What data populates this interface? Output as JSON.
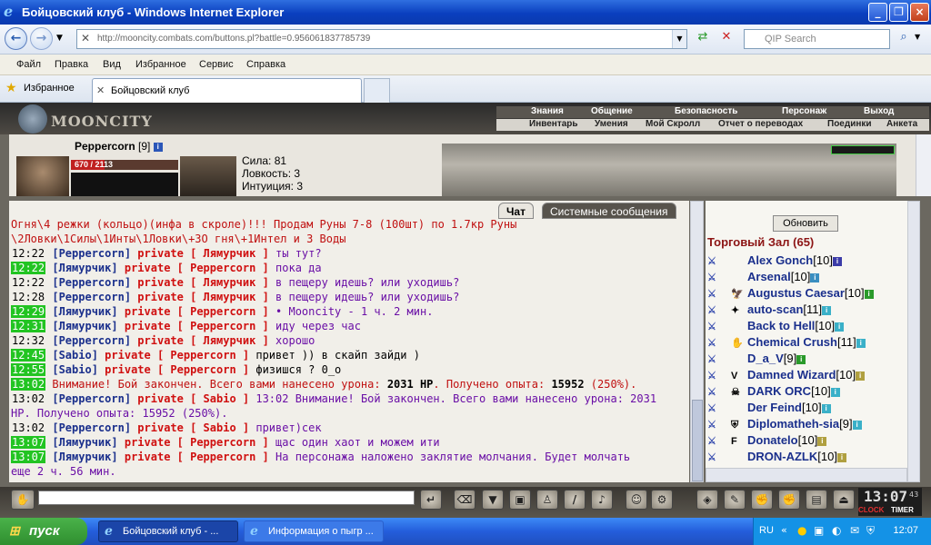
{
  "window": {
    "title": "Бойцовский клуб - Windows Internet Explorer"
  },
  "nav": {
    "url": "http://mooncity.combats.com/buttons.pl?battle=0.956061837785739",
    "search_placeholder": "QIP Search"
  },
  "menu": [
    "Файл",
    "Правка",
    "Вид",
    "Избранное",
    "Сервис",
    "Справка"
  ],
  "favorites_label": "Избранное",
  "tab_label": "Бойцовский клуб",
  "game": {
    "logo": "MOONCITY",
    "menu_top": [
      "Знания",
      "Общение",
      "Безопасность",
      "Персонаж",
      "Выход"
    ],
    "menu_bottom": [
      "Инвентарь",
      "Умения",
      "Мой Скролл",
      "Отчет о переводах",
      "Поединки",
      "Анкета"
    ]
  },
  "player": {
    "nick": "Peppercorn",
    "level": "[9]",
    "hp_text": "670 / 2113",
    "hp_fraction": 0.317
  },
  "stats": [
    "Сила: 81",
    "Ловкость: 3",
    "Интуиция: 3"
  ],
  "chat": {
    "tabs": [
      "Чат",
      "Системные сообщения"
    ],
    "lines": [
      {
        "cls": "rd",
        "parts": [
          {
            "c": "rd",
            "t": "Огня\\4 режки (кольцо)(инфа в скроле)!!! Продам Руны 7-8 (100шт) по 1.7кр"
          },
          {
            "c": "rd",
            "t": "   Руны"
          }
        ]
      },
      {
        "cls": "rd",
        "parts": [
          {
            "c": "rd",
            "t": "\\2Ловки\\1Силы\\1Инты\\1Ловки\\+3О гня\\+1Интел и 3 Воды"
          }
        ]
      },
      {
        "t": "12:22",
        "g": false,
        "nick": "[Peppercorn]",
        "priv": "private [ Лямурчик ]",
        "msg": "ты тут?",
        "mc": "pk"
      },
      {
        "t": "12:22",
        "g": true,
        "nick": "[Лямурчик]",
        "priv": "private [ Peppercorn ]",
        "msg": "пока да",
        "mc": "pk"
      },
      {
        "t": "12:22",
        "g": false,
        "nick": "[Peppercorn]",
        "priv": "private [ Лямурчик ]",
        "msg": "в пещеру идешь? или уходишь?",
        "mc": "pk"
      },
      {
        "t": "12:28",
        "g": false,
        "nick": "[Peppercorn]",
        "priv": "private [ Лямурчик ]",
        "msg": "в пещеру идешь? или уходишь?",
        "mc": "pk"
      },
      {
        "t": "12:29",
        "g": true,
        "nick": "[Лямурчик]",
        "priv": "private [ Peppercorn ]",
        "msg": "• Mooncity - 1 ч. 2 мин.",
        "mc": "pk"
      },
      {
        "t": "12:31",
        "g": true,
        "nick": "[Лямурчик]",
        "priv": "private [ Peppercorn ]",
        "msg": "иду через час",
        "mc": "pk"
      },
      {
        "t": "12:32",
        "g": false,
        "nick": "[Peppercorn]",
        "priv": "private [ Лямурчик ]",
        "msg": "хорошо",
        "mc": "pk"
      },
      {
        "t": "12:45",
        "g": true,
        "nick": "[Sabio]",
        "priv": "private [ Peppercorn ]",
        "msg": "привет )) в скайп зайди )",
        "mc": "bk"
      },
      {
        "t": "12:55",
        "g": true,
        "nick": "[Sabio]",
        "priv": "private [ Peppercorn ]",
        "msg": "физишся ? 0_o",
        "mc": "bk"
      },
      {
        "t": "13:02",
        "g": true,
        "sys": true,
        "pre": "Внимание! Бой закончен. Всего вами нанесено урона: ",
        "b1": "2031 HP",
        "mid": ". Получено опыта: ",
        "b2": "15952",
        "post": " (250%)."
      },
      {
        "t": "13:02",
        "g": false,
        "nick": "[Peppercorn]",
        "priv": "private [ Sabio ]",
        "msg": "13:02 Внимание! Бой закончен. Всего вами нанесено урона: 2031",
        "mc": "pk"
      },
      {
        "cls": "pk",
        "parts": [
          {
            "c": "pk",
            "t": "HP. Получено опыта: 15952 (250%)."
          }
        ]
      },
      {
        "t": "13:02",
        "g": false,
        "nick": "[Peppercorn]",
        "priv": "private [ Sabio ]",
        "msg": "привет)сек",
        "mc": "pk"
      },
      {
        "t": "13:07",
        "g": true,
        "nick": "[Лямурчик]",
        "priv": "private [ Peppercorn ]",
        "msg": "щас один хаот и можем ити",
        "mc": "pk"
      },
      {
        "t": "13:07",
        "g": true,
        "nick": "[Лямурчик]",
        "priv": "private [ Peppercorn ]",
        "msg": "На персонажа наложено заклятие молчания. Будет молчать",
        "mc": "pk"
      },
      {
        "cls": "pk",
        "parts": [
          {
            "c": "pk",
            "t": "еще 2 ч. 56 мин."
          }
        ]
      }
    ]
  },
  "hall": {
    "refresh": "Обновить",
    "title": "Торговый Зал (65)",
    "players": [
      {
        "ic": "⚔",
        "cl": "",
        "name": "Alex Gonch",
        "lvl": "[10]",
        "ib": "#3c3ca8"
      },
      {
        "ic": "⚔",
        "cl": "",
        "name": "Arsenal",
        "lvl": "[10]",
        "ib": "#3a8ec0"
      },
      {
        "ic": "⚔",
        "cl": "🦅",
        "name": "Augustus Caesar",
        "lvl": "[10]",
        "ib": "#2a9a2a"
      },
      {
        "ic": "⚔",
        "cl": "✦",
        "name": "auto-scan",
        "lvl": "[11]",
        "ib": "#3ab0c8"
      },
      {
        "ic": "⚔",
        "cl": "",
        "name": "Back to Hell",
        "lvl": "[10]",
        "ib": "#3ab0c8"
      },
      {
        "ic": "⚔",
        "cl": "✋",
        "name": "Chemical Crush",
        "lvl": "[11]",
        "ib": "#3ab0c8"
      },
      {
        "ic": "⚔",
        "cl": "",
        "name": "D_a_V",
        "lvl": "[9]",
        "ib": "#2a9a2a"
      },
      {
        "ic": "⚔",
        "cl": "V",
        "name": "Damned Wizard",
        "lvl": "[10]",
        "ib": "#b0a040"
      },
      {
        "ic": "⚔",
        "cl": "☠",
        "name": "DARK ORC",
        "lvl": "[10]",
        "ib": "#3ab0c8"
      },
      {
        "ic": "⚔",
        "cl": "",
        "name": "Der Feind",
        "lvl": "[10]",
        "ib": "#3ab0c8"
      },
      {
        "ic": "⚔",
        "cl": "⛨",
        "name": "Diplomatheh-sia",
        "lvl": "[9]",
        "ib": "#3ab0c8"
      },
      {
        "ic": "⚔",
        "cl": "F",
        "name": "Donatelo",
        "lvl": "[10]",
        "ib": "#b0a040"
      },
      {
        "ic": "⚔",
        "cl": "",
        "name": "DRON-AZLK",
        "lvl": "[10]",
        "ib": "#b0a040"
      }
    ]
  },
  "clock": {
    "time": "13:07",
    "sec": "43",
    "label1": "CLOCK",
    "label2": "TIMER"
  },
  "taskbar": {
    "start": "пуск",
    "tasks": [
      "Бойцовский клуб - ...",
      "Информация о пыгр ..."
    ],
    "lang": "RU",
    "time": "12:07"
  }
}
